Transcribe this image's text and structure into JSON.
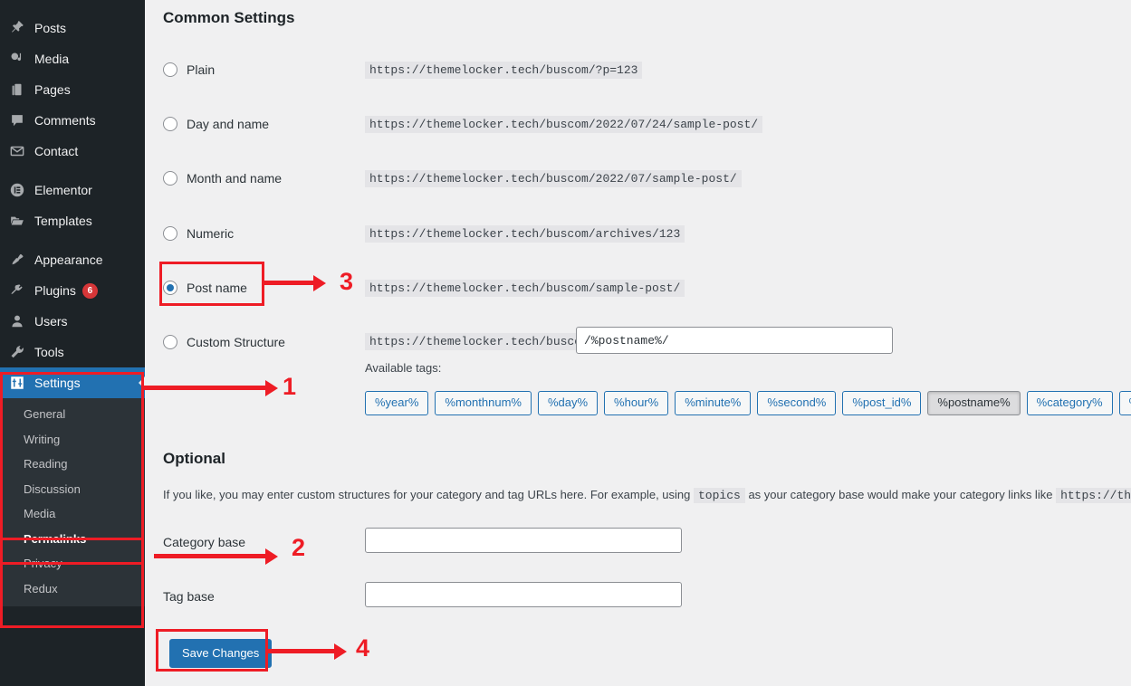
{
  "sidebar": {
    "items": [
      {
        "label": "Posts",
        "icon": "pushpin-icon",
        "badge": null
      },
      {
        "label": "Media",
        "icon": "media-icon",
        "badge": null
      },
      {
        "label": "Pages",
        "icon": "pages-icon",
        "badge": null
      },
      {
        "label": "Comments",
        "icon": "comment-bubble-icon",
        "badge": null
      },
      {
        "label": "Contact",
        "icon": "envelope-icon",
        "badge": null
      },
      {
        "label": "Elementor",
        "icon": "elementor-icon",
        "badge": null
      },
      {
        "label": "Templates",
        "icon": "folder-icon",
        "badge": null
      },
      {
        "label": "Appearance",
        "icon": "paintbrush-icon",
        "badge": null
      },
      {
        "label": "Plugins",
        "icon": "plug-icon",
        "badge": "6"
      },
      {
        "label": "Users",
        "icon": "user-icon",
        "badge": null
      },
      {
        "label": "Tools",
        "icon": "wrench-icon",
        "badge": null
      },
      {
        "label": "Settings",
        "icon": "sliders-icon",
        "badge": null,
        "current": true
      }
    ],
    "settings_submenu": [
      {
        "label": "General"
      },
      {
        "label": "Writing"
      },
      {
        "label": "Reading"
      },
      {
        "label": "Discussion"
      },
      {
        "label": "Media"
      },
      {
        "label": "Permalinks",
        "current": true
      },
      {
        "label": "Privacy"
      },
      {
        "label": "Redux"
      }
    ],
    "colors": {
      "background": "#1d2327",
      "submenu_background": "#2c3338",
      "current_highlight": "#2271b1",
      "badge": "#d63638"
    }
  },
  "main": {
    "common_settings_heading": "Common Settings",
    "permalink_options": [
      {
        "label": "Plain",
        "url": "https://themelocker.tech/buscom/?p=123",
        "selected": false
      },
      {
        "label": "Day and name",
        "url": "https://themelocker.tech/buscom/2022/07/24/sample-post/",
        "selected": false
      },
      {
        "label": "Month and name",
        "url": "https://themelocker.tech/buscom/2022/07/sample-post/",
        "selected": false
      },
      {
        "label": "Numeric",
        "url": "https://themelocker.tech/buscom/archives/123",
        "selected": false
      },
      {
        "label": "Post name",
        "url": "https://themelocker.tech/buscom/sample-post/",
        "selected": true
      },
      {
        "label": "Custom Structure",
        "url": "https://themelocker.tech/buscom",
        "selected": false
      }
    ],
    "custom_structure_value": "/%postname%/",
    "available_tags_label": "Available tags:",
    "available_tags": [
      {
        "label": "%year%",
        "active": false
      },
      {
        "label": "%monthnum%",
        "active": false
      },
      {
        "label": "%day%",
        "active": false
      },
      {
        "label": "%hour%",
        "active": false
      },
      {
        "label": "%minute%",
        "active": false
      },
      {
        "label": "%second%",
        "active": false
      },
      {
        "label": "%post_id%",
        "active": false
      },
      {
        "label": "%postname%",
        "active": true
      },
      {
        "label": "%category%",
        "active": false
      },
      {
        "label": "%aut",
        "active": false
      }
    ],
    "optional_heading": "Optional",
    "optional_desc_part1": "If you like, you may enter custom structures for your category and tag URLs here. For example, using",
    "optional_desc_code1": "topics",
    "optional_desc_part2": "as your category base would make your category links like",
    "optional_desc_code2": "https://th",
    "category_base_label": "Category base",
    "category_base_value": "",
    "tag_base_label": "Tag base",
    "tag_base_value": "",
    "save_label": "Save Changes"
  },
  "annotations": {
    "numbers": [
      "1",
      "2",
      "3",
      "4"
    ],
    "color": "#ee1c25"
  }
}
